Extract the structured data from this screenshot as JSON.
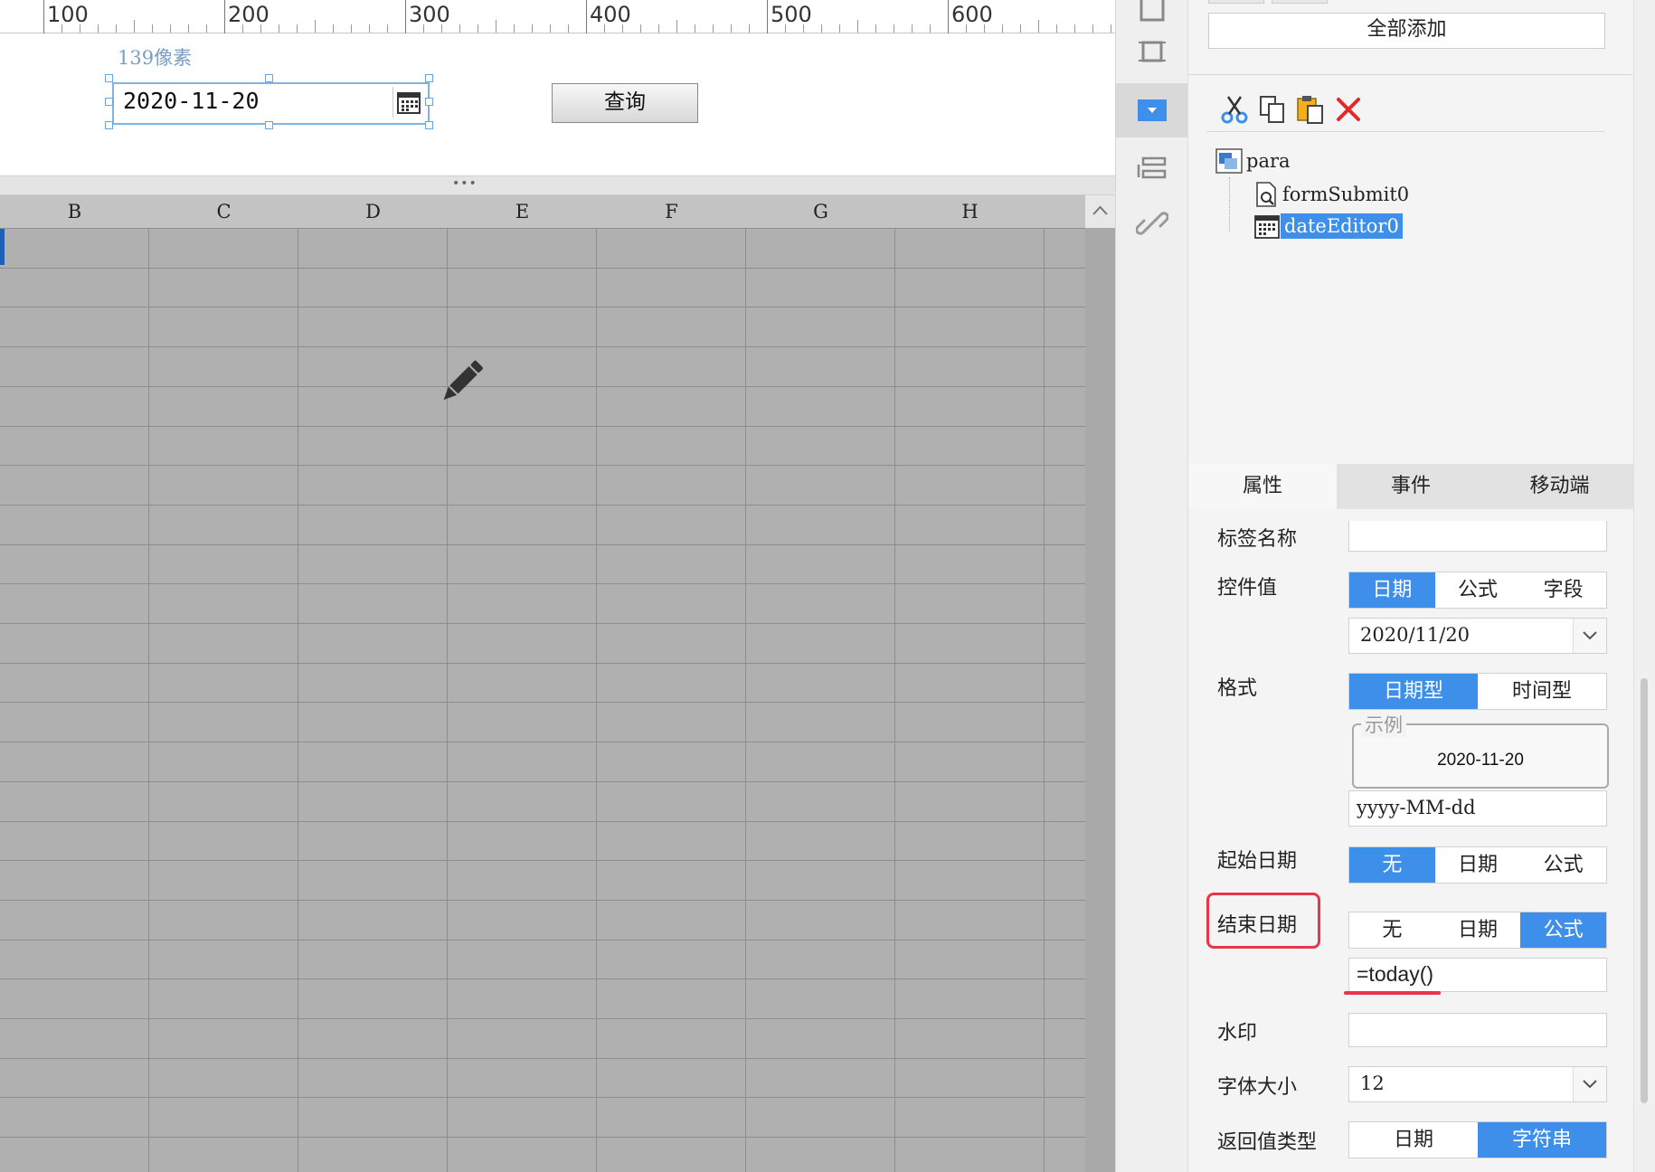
{
  "ruler": {
    "labels": [
      "100",
      "200",
      "300",
      "400",
      "500",
      "600"
    ]
  },
  "design": {
    "pixel_hint": "139像素",
    "date_editor_value": "2020-11-20",
    "query_button": "查询"
  },
  "sheet": {
    "columns": [
      "B",
      "C",
      "D",
      "E",
      "F",
      "G",
      "H"
    ]
  },
  "toolbar": {
    "icons": [
      "layout-icon",
      "frame-icon",
      "dropdown-widget-icon",
      "list-widget-icon",
      "link-icon"
    ]
  },
  "panel": {
    "add_all_label": "全部添加",
    "edit_icons": [
      "cut-icon",
      "copy-icon",
      "paste-icon",
      "delete-icon"
    ],
    "tree": {
      "root": "para",
      "children": [
        "formSubmit0",
        "dateEditor0"
      ],
      "selected": "dateEditor0"
    },
    "tabs": [
      "属性",
      "事件",
      "移动端"
    ],
    "active_tab": "属性",
    "properties": {
      "label_name": {
        "label": "标签名称",
        "value": ""
      },
      "control_value": {
        "label": "控件值",
        "options": [
          "日期",
          "公式",
          "字段"
        ],
        "selected": "日期",
        "date_value": "2020/11/20"
      },
      "format": {
        "label": "格式",
        "options": [
          "日期型",
          "时间型"
        ],
        "selected": "日期型",
        "example_caption": "示例",
        "example_value": "2020-11-20",
        "pattern": "yyyy-MM-dd"
      },
      "start_date": {
        "label": "起始日期",
        "options": [
          "无",
          "日期",
          "公式"
        ],
        "selected": "无"
      },
      "end_date": {
        "label": "结束日期",
        "options": [
          "无",
          "日期",
          "公式"
        ],
        "selected": "公式",
        "formula": "=today()"
      },
      "watermark": {
        "label": "水印",
        "value": ""
      },
      "font_size": {
        "label": "字体大小",
        "value": "12"
      },
      "return_type": {
        "label": "返回值类型",
        "options": [
          "日期",
          "字符串"
        ],
        "selected": "字符串"
      }
    }
  },
  "colors": {
    "accent": "#3d8fe9",
    "highlight": "#e8364a",
    "grid": "#b0b0b0"
  }
}
